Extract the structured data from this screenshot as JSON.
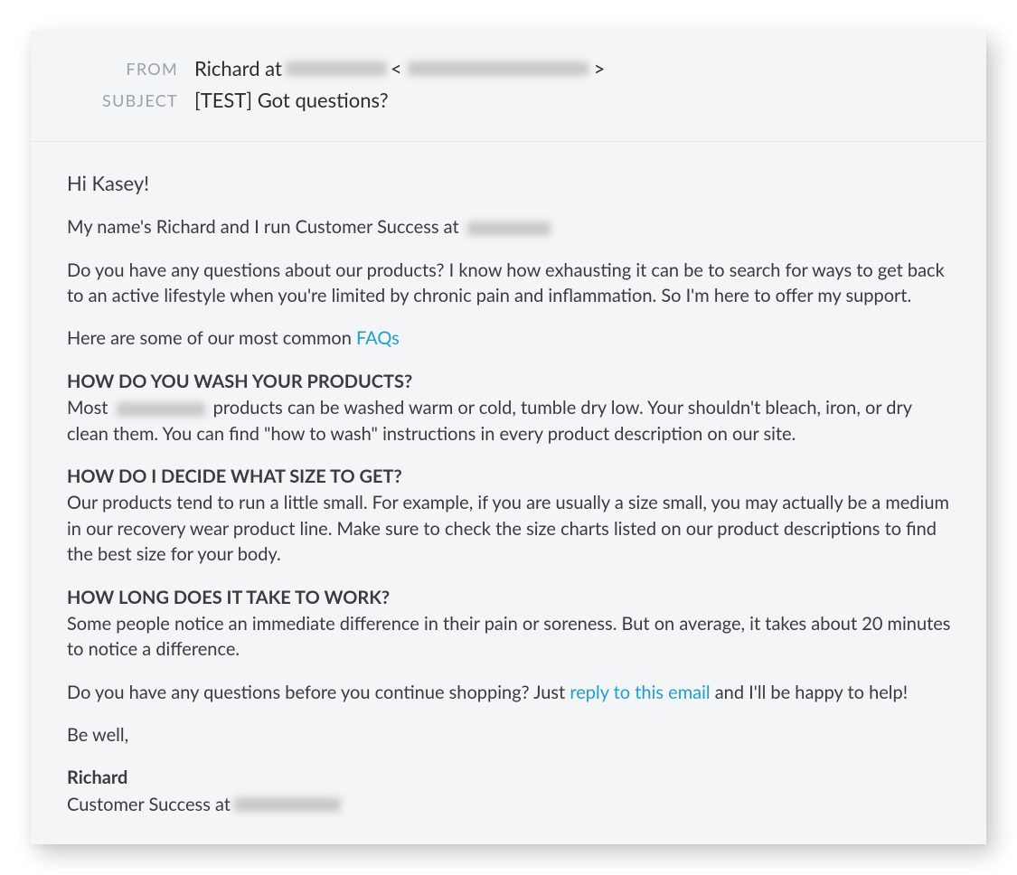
{
  "header": {
    "from_label": "FROM",
    "from_value_prefix": "Richard at ",
    "from_angle_open": " < ",
    "from_angle_close": " >",
    "subject_label": "SUBJECT",
    "subject_value": "[TEST] Got questions?"
  },
  "body": {
    "greeting": "Hi Kasey!",
    "intro_prefix": "My name's Richard and I run Customer Success at ",
    "p_questions": "Do you have any questions about our products? I know how exhausting it can be to search for ways to get back to an active lifestyle when you're limited by chronic pain and inflammation. So I'm here to offer my support.",
    "faq_lead": "Here are some of our most common ",
    "faq_link": "FAQs",
    "faq1_heading": "HOW DO YOU WASH YOUR PRODUCTS?",
    "faq1_prefix": "Most ",
    "faq1_suffix": " products can be washed warm or cold, tumble dry low. Your shouldn't bleach, iron, or dry clean them. You can find \"how to wash\" instructions in every product description on our site.",
    "faq2_heading": "HOW DO I DECIDE WHAT SIZE TO GET?",
    "faq2_body": "Our products tend to run a little small. For example, if you are usually a size small, you may actually be a medium in our recovery wear product line. Make sure to check the size charts listed on our product descriptions to find the best size for your body.",
    "faq3_heading": "HOW LONG DOES IT TAKE TO WORK?",
    "faq3_body": "Some people notice an immediate difference in their pain or soreness. But on average, it takes about 20 minutes to notice a difference.",
    "cta_prefix": "Do you have any questions before you continue shopping? Just ",
    "cta_link": "reply to this email",
    "cta_suffix": " and I'll be happy to help!",
    "signoff": "Be well,",
    "sig_name": "Richard",
    "sig_title_prefix": "Customer Success at "
  }
}
